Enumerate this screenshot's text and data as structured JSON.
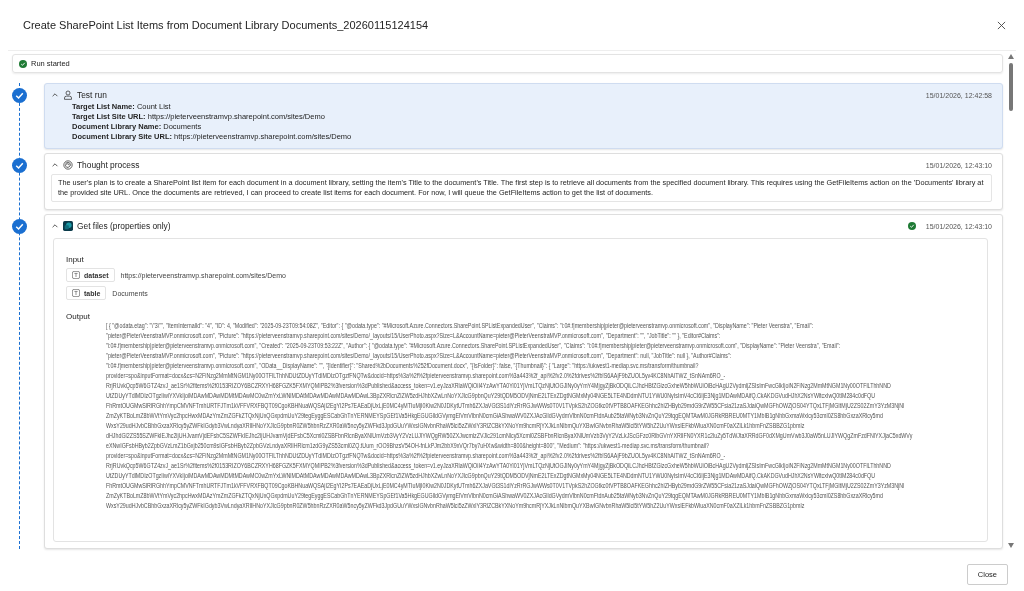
{
  "dialog": {
    "title": "Create SharePoint List Items from Document Library Documents_20260115124154"
  },
  "run_status": {
    "label": "Run started"
  },
  "steps": [
    {
      "kind": "input",
      "title": "Test run",
      "timestamp": "15/01/2026, 12:42:58",
      "selected": true,
      "expanded": true,
      "fields": [
        "**Target List Name:** Count List",
        "**Target List Site URL:** https://pieterveenstramvp.sharepoint.com/sites/Demo",
        "**Document Library Name:** Documents",
        "**Document Library Site URL:** https://pieterveenstramvp.sharepoint.com/sites/Demo"
      ]
    },
    {
      "kind": "thought",
      "title": "Thought process",
      "timestamp": "15/01/2026, 12:43:10",
      "selected": false,
      "expanded": true,
      "text": "The user's plan is to create a SharePoint list item for each document in a document library, setting the item's Title to the document's Title. The first step is to retrieve all documents from the specified document library. This requires using the GetFileItems action on the 'Documents' library at the provided site URL. Once the documents are retrieved, I can proceed to create list items for each document. For now, I will queue the GetFileItems action to get the list of documents."
    },
    {
      "kind": "action",
      "title": "Get files (properties only)",
      "timestamp": "15/01/2026, 12:43:10",
      "selected": false,
      "expanded": true,
      "succeeded": true,
      "input_label": "Input",
      "inputs": [
        {
          "name": "dataset",
          "value": "https://pieterveenstramvp.sharepoint.com/sites/Demo"
        },
        {
          "name": "table",
          "value": "Documents"
        }
      ],
      "output_label": "Output",
      "output_lines": [
        "[ { \"@odata.etag\": \"\\\"3\\\"\", \"ItemInternalId\": \"4\", \"ID\": 4, \"Modified\": \"2025-09-23T09:54:08Z\", \"Editor\": { \"@odata.type\": \"#Microsoft.Azure.Connectors.SharePoint.SPListExpandedUser\", \"Claims\": \"i:0#.f|membership|pieter@pieterveenstramvp.onmicrosoft.com\", \"DisplayName\": \"Pieter Veenstra\", \"Email\":",
        "\"pieter@PieterVeenstraMVP.onmicrosoft.com\", \"Picture\": \"https://pieterveenstramvp.sharepoint.com/sites/Demo/_layouts/15/UserPhoto.aspx?Size=L&AccountName=pieter@PieterVeenstraMVP.onmicrosoft.com\", \"Department\": \"\", \"JobTitle\": \"\" }, \"Editor#Claims\":",
        "\"i:0#.f|membership|pieter@pieterveenstramvp.onmicrosoft.com\", \"Created\": \"2025-09-23T09:53:22Z\", \"Author\": { \"@odata.type\": \"#Microsoft.Azure.Connectors.SharePoint.SPListExpandedUser\", \"Claims\": \"i:0#.f|membership|pieter@pieterveenstramvp.onmicrosoft.com\", \"DisplayName\": \"Pieter Veenstra\", \"Email\":",
        "\"pieter@PieterVeenstraMVP.onmicrosoft.com\", \"Picture\": \"https://pieterveenstramvp.sharepoint.com/sites/Demo/_layouts/15/UserPhoto.aspx?Size=L&AccountName=pieter@PieterVeenstraMVP.onmicrosoft.com\", \"Department\": null, \"JobTitle\": null }, \"Author#Claims\":",
        "\"i:0#.f|membership|pieter@pieterveenstramvp.onmicrosoft.com\", \"OData__DisplayName\": \"\", \"{Identifier}\": \"Shared%2bDocuments%252fDocument.docx\", \"{IsFolder}\": false, \"{Thumbnail}\": { \"Large\": \"https://ukwest1-mediap.svc.ms/transform/thumbnail?",
        "provider=spo&inputFormat=docx&cs=N2FiNzg2MmMtNGM1Ny00OTFlLThhNDUtZDUyYTdlMDIzOTgzfFNQTw&docid=https%3a%2f%2fpieterveenstramvp.sharepoint.com%3a443%2f_api%2fv2.0%2fdrives%2fb!S6AAjF9bZUOL5yv4KC8NhAITWZ_tSnNAm6RO_-",
        "RrjRUvkQcp5W6GTZ4zvJ_ae1Sr%2fitems%2f0153RIZOY6BCZRXYH68FGZK5FXMYQMIPB2%3fversion%3dPublished&access_token=v1.eyJzaXRlaWQiOiI4YzAwYTA0Yi01YjVmLTQzNjUtOGJlNy0yYmY4MjgyZjBkODQiLCJhcHBfZGlzcGxheW5hbWUiOiBcHAgU2VydmljZSIsImFwcGlkIjoiN2FiNzg2MmMtNGM1Ny00OTFlLThhNND",
        "UtZDUyYTdlMDIzOTgzIiwiYXVkIjoiMDAwMDAwMDMtMDAwMC0wZmYxLWNlMDAtMDAwMDAwMDAwMDAwL3BpZXRlcnZlZW5zdHJhbXZwLnNoYXJlcG9pbnQuY29tQDM5ODVjNmE2LTExZDgtNGMxMy04NGE5LTE4NDdmNTU1YWU0NyIsImV4cCI6IjE3Njg1MDAwMDAifQ.CkAKDGVudHJhX2NsYWltcxIwQ0tlM284c0dFQU",
        "FhRmtOUGMwSlRlRGhhYmpCMVNFTmhURTFJTm1kVFFVRXFBQT09CgoKBHNuaWQSAjI2EgYI2Ps7EAEaDjUxLjE0MC4yMTIuMjI0Kiw2N0JDKytUTmh6ZXJaVGt3S1diYzRrRGJwWWs0T0V1TVpkS2hZOGtkc0tVPTB8OAFKEGhhc2hlZHByb29mdG9rZW55CFsia21zaSJdaiQwMGFhOWZjOS04YTQxLTFjMGItMjU2ZS02ZmY3YzM3NjNl",
        "ZmZyKTBoLmZ8bWVtYmVyc2hpcHwxMDAzYmZmZGFkZTQxNjUxQGxpdmUuY29tegEyggESCabGhTnYERNMEYSpGEf1Va5HkgEGUGlldGVymgElVmVlbnN0cmGiAShwaWV0ZXJAcGlldGVydmVlbnN0cmFtdnAub25taWNyb3NvZnQuY29tqgEQMTAwM0JGRkRBREU0MTY1MbIB1gNhbGxmaWxlcy53cml0ZS8hbGxzaXRlcy5md",
        "WxsY29udHJvbCBhbGxzaXRlcy5yZWFkIGdyb3VwLndyaXRlIHNoYXJlcG9pbnR0ZW5hbnRzZXR0aW5ncy5yZWFkd3JpdGUuYWxsIGNvbnRhaW5lci5zZWxlY3RlZCBkYXNoYm9hcmRjYXJkLnNlbmQuYXBwIGNvbnRhaW5lci5tYW5hZ2UuYWxsIEFkbWluaXN0cmF0aXZlLk1hbmFnZSBBZG1pbmlz",
        "dHJhdGl2ZS55SZWFkIEJhc2ljUHJvamVjdEFsbC5SZWFkIEJhc2ljUHJvamVjdEFsbC5Xcml0ZSBFbnRlcnByaXNlUmVzb3VyY2VzLUJlYWQgRW50ZXJwcmlzZVJlc291cmNlcy5Xcml0ZSBFbnRlcnByaXNlUmVzb3VyY2VzLkJScGFzc0RlbGVnYXRlIFN0YXR1c2luZy5TdWJtaXRRdGF0dXMgUmVwb3J0aW5nLUJlYWQgZmFzdFNlYXJjaC5xdWVy",
        "eXNwIGFsbHByb2ZpbGVzLmZ1bGxjb250cm9sIGFsbHByb2ZpbGVzLndyaXRlIHRlcm1zdG9yZS53cml0ZQ.tUum_rOO9BhzsV54OH-fnLkPJm2bbX9xVQr7by7uHXw&width=800&height=800\", \"Medium\": \"https://ukwest1-mediap.svc.ms/transform/thumbnail?",
        "provider=spo&inputFormat=docx&cs=N2FiNzg2MmMtNGM1Ny00OTFlLThhNDUtZDUyYTdlMDIzOTgzfFNQTw&docid=https%3a%2f%2fpieterveenstramvp.sharepoint.com%3a443%2f_api%2fv2.0%2fdrives%2fb!S6AAjF9bZUOL5yv4KC8NhAITWZ_tSnNAm6RO_-",
        "RrjRUvkQcp5W6GTZ4zvJ_ae1Sr%2fitems%2f0153RIZOY6BCZRXYH68FGZK5FXMYQMIPB2%3fversion%3dPublished&access_token=v1.eyJzaXRlaWQiOiI4YzAwYTA0Yi01YjVmLTQzNjUtOGJlNy0yYmY4MjgyZjBkODQiLCJhcHBfZGlzcGxheW5hbWUiOiBcHAgU2VydmljZSIsImFwcGlkIjoiN2FiNzg2MmMtNGM1Ny00OTFlLThhNND",
        "UtZDUyYTdlMDIzOTgzIiwiYXVkIjoiMDAwMDAwMDMtMDAwMC0wZmYxLWNlMDAtMDAwMDAwMDAwMDAwL3BpZXRlcnZlZW5zdHJhbXZwLnNoYXJlcG9pbnQuY29tQDM5ODVjNmE2LTExZDgtNGMxMy04NGE5LTE4NDdmNTU1YWU0NyIsImV4cCI6IjE3Njg1MDAwMDAifQ.CkAKDGVudHJhX2NsYWltcxIwQ0tlM284c0dFQU",
        "FhRmtOUGMwSlRlRGhhYmpCMVNFTmhURTFJTm1kVFFVRXFBQT09CgoKBHNuaWQSAjI2EgYI2Ps7EAEaDjUxLjE0MC4yMTIuMjI0Kiw2N0JDKytUTmh6ZXJaVGt3S1diYzRrRGJwWWs0T0V1TVpkS2hZOGtkc0tVPTB8OAFKEGhhc2hlZHByb29mdG9rZW55CFsia21zaSJdaiQwMGFhOWZjOS04YTQxLTFjMGItMjU2ZS02ZmY3YzM3NjNl",
        "ZmZyKTBoLmZ8bWVtYmVyc2hpcHwxMDAzYmZmZGFkZTQxNjUxQGxpdmUuY29tegEyggESCabGhTnYERNMEYSpGEf1Va5HkgEGUGlldGVymgElVmVlbnN0cmGiAShwaWV0ZXJAcGlldGVydmVlbnN0cmFtdnAub25taWNyb3NvZnQuY29tqgEQMTAwM0JGRkRBREU0MTY1MbIB1gNhbGxmaWxlcy53cml0ZS8hbGxzaXRlcy5md",
        "WxsY29udHJvbCBhbGxzaXRlcy5yZWFkIGdyb3VwLndyaXRlIHNoYXJlcG9pbnR0ZW5hbnRzZXR0aW5ncy5yZWFkd3JpdGUuYWxsIGNvbnRhaW5lci5zZWxlY3RlZCBkYXNoYm9hcmRjYXJkLnNlbmQuYXBwIGNvbnRhaW5lci5tYW5hZ2UuYWxsIEFkbWluaXN0cmF0aXZlLk1hbmFnZSBBZG1pbmlz"
      ]
    }
  ],
  "footer": {
    "close_button": "Close"
  }
}
